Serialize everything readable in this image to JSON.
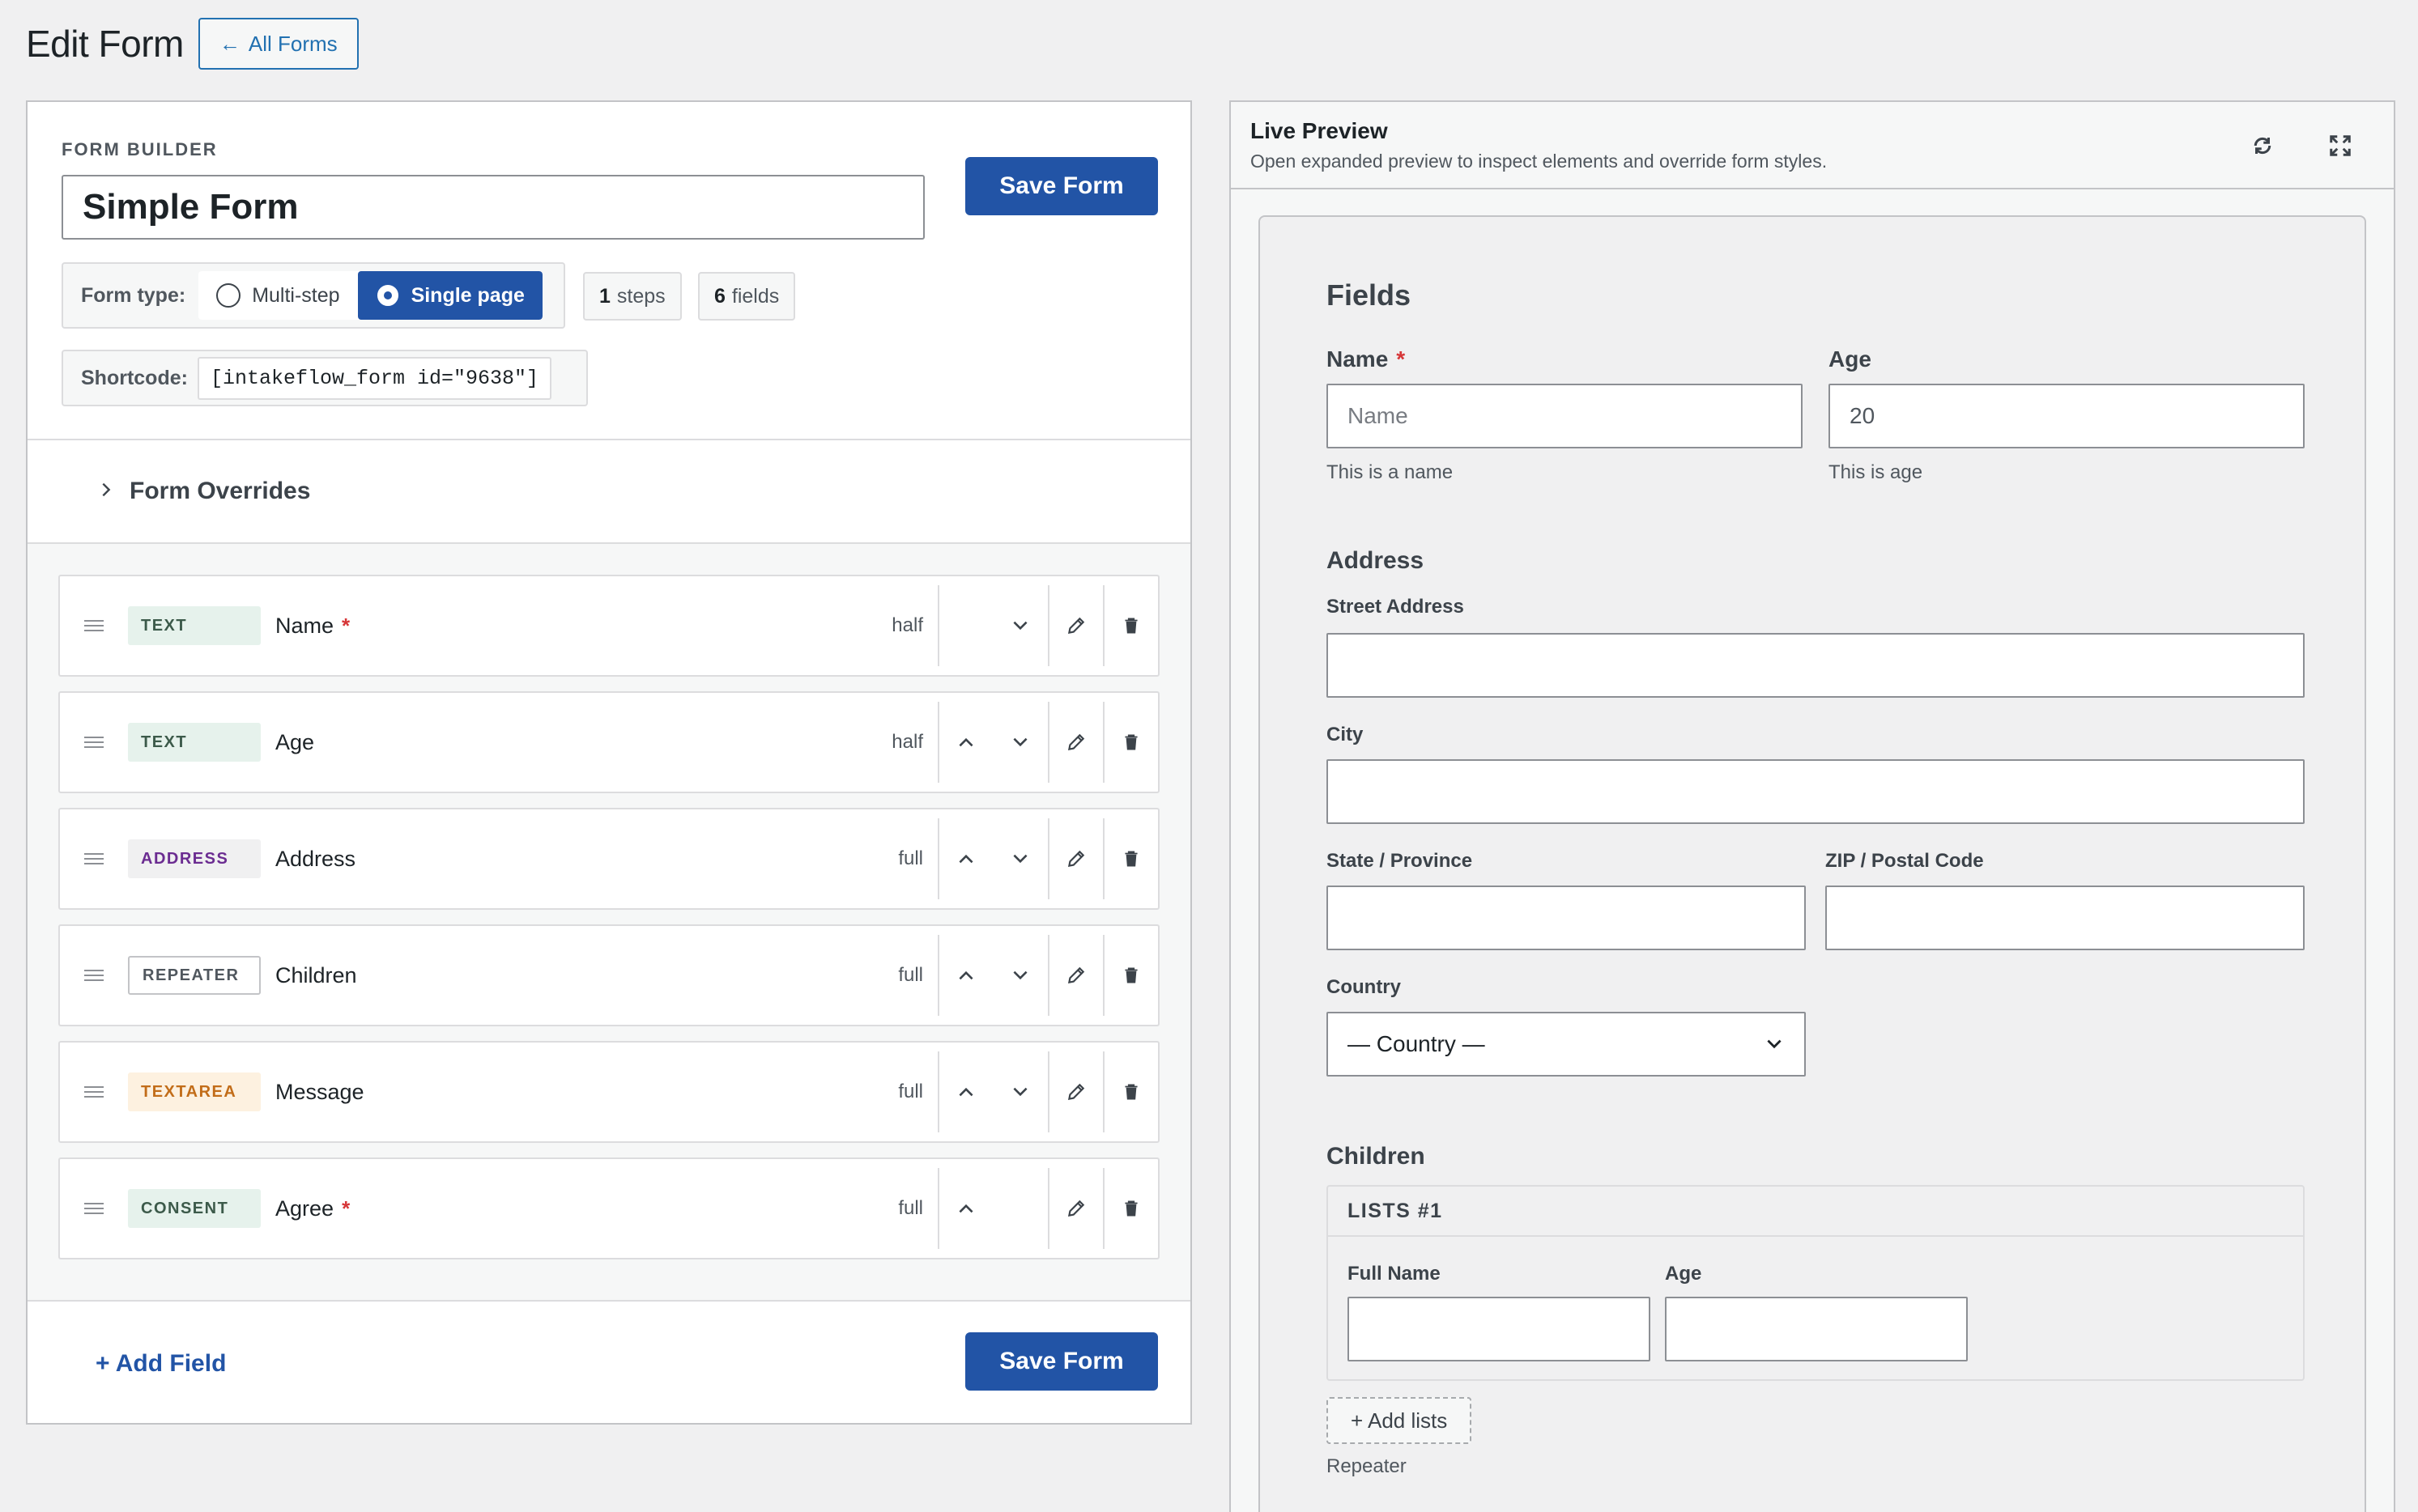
{
  "header": {
    "title": "Edit Form",
    "back_label": "All Forms"
  },
  "builder": {
    "section_label": "FORM BUILDER",
    "form_name": "Simple Form",
    "save_label": "Save Form",
    "form_type_label": "Form type:",
    "form_type_options": [
      {
        "label": "Multi-step",
        "selected": false
      },
      {
        "label": "Single page",
        "selected": true
      }
    ],
    "steps_count": "1",
    "steps_label": "steps",
    "fields_count": "6",
    "fields_label": "fields",
    "shortcode_label": "Shortcode:",
    "shortcode_value": "[intakeflow_form id=\"9638\"]",
    "overrides_label": "Form Overrides",
    "add_field_label": "+ Add Field",
    "fields": [
      {
        "type": "TEXT",
        "label": "Name",
        "required": true,
        "width": "half"
      },
      {
        "type": "TEXT",
        "label": "Age",
        "required": false,
        "width": "half"
      },
      {
        "type": "ADDRESS",
        "label": "Address",
        "required": false,
        "width": "full"
      },
      {
        "type": "REPEATER",
        "label": "Children",
        "required": false,
        "width": "full"
      },
      {
        "type": "TEXTAREA",
        "label": "Message",
        "required": false,
        "width": "full"
      },
      {
        "type": "CONSENT",
        "label": "Agree",
        "required": true,
        "width": "full"
      }
    ],
    "required_mark": "*"
  },
  "preview": {
    "title": "Live Preview",
    "subtitle": "Open expanded preview to inspect elements and override form styles.",
    "heading": "Fields",
    "name_label": "Name",
    "name_placeholder": "Name",
    "name_help": "This is a name",
    "age_label": "Age",
    "age_value": "20",
    "age_help": "This is age",
    "address_heading": "Address",
    "street_label": "Street Address",
    "city_label": "City",
    "state_label": "State / Province",
    "zip_label": "ZIP / Postal Code",
    "country_label": "Country",
    "country_value": "— Country —",
    "children_heading": "Children",
    "repeater_item_title": "LISTS #1",
    "child_fullname_label": "Full Name",
    "child_age_label": "Age",
    "add_lists_label": "+ Add lists",
    "repeater_help": "Repeater"
  },
  "colors": {
    "primary": "#2254a6",
    "link": "#2271b1",
    "required": "#d63638"
  }
}
